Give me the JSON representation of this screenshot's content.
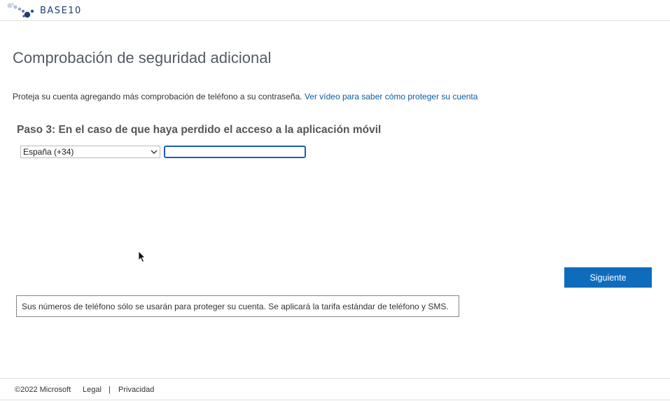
{
  "header": {
    "logo_text": "BASE10"
  },
  "main": {
    "title": "Comprobación de seguridad adicional",
    "intro_text": "Proteja su cuenta agregando más comprobación de teléfono a su contraseña.",
    "intro_link": "Ver vídeo para saber cómo proteger su cuenta",
    "step_title": "Paso 3: En el caso de que haya perdido el acceso a la aplicación móvil",
    "country_select": {
      "value": "España (+34)"
    },
    "phone_input": {
      "value": ""
    },
    "next_button": "Siguiente",
    "notice": "Sus números de teléfono sólo se usarán para proteger su cuenta. Se aplicará la tarifa estándar de teléfono y SMS."
  },
  "footer": {
    "copyright": "©2022 Microsoft",
    "legal": "Legal",
    "separator": "|",
    "privacy": "Privacidad"
  },
  "colors": {
    "primary_button": "#0f6cbd",
    "link": "#0b5aa5",
    "logo": "#1f3d73"
  }
}
